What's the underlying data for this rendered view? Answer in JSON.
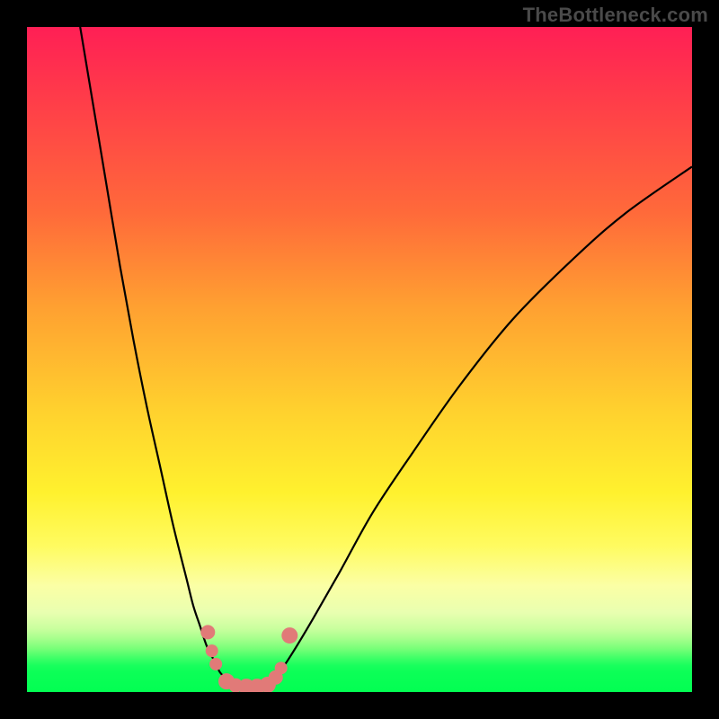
{
  "watermark": {
    "text": "TheBottleneck.com"
  },
  "chart_data": {
    "type": "line",
    "title": "",
    "xlabel": "",
    "ylabel": "",
    "xlim": [
      0,
      100
    ],
    "ylim": [
      0,
      100
    ],
    "grid": false,
    "legend": false,
    "series": [
      {
        "name": "curve-left",
        "x": [
          8,
          10,
          12,
          14,
          16,
          18,
          20,
          22,
          24,
          25,
          26,
          27,
          28,
          29,
          30
        ],
        "y": [
          100,
          88,
          76,
          64,
          53,
          43,
          34,
          25,
          17,
          13,
          10,
          7,
          5,
          3,
          2
        ],
        "stroke": "#000000",
        "stroke_width": 2.2
      },
      {
        "name": "curve-right",
        "x": [
          37,
          38,
          40,
          43,
          47,
          52,
          58,
          65,
          73,
          82,
          90,
          100
        ],
        "y": [
          2,
          3,
          6,
          11,
          18,
          27,
          36,
          46,
          56,
          65,
          72,
          79
        ],
        "stroke": "#000000",
        "stroke_width": 2.2
      },
      {
        "name": "markers",
        "marker_color": "#e17a78",
        "points": [
          {
            "x": 27.2,
            "y": 9.0,
            "r": 8
          },
          {
            "x": 27.8,
            "y": 6.2,
            "r": 7
          },
          {
            "x": 28.4,
            "y": 4.2,
            "r": 7
          },
          {
            "x": 30.0,
            "y": 1.6,
            "r": 9
          },
          {
            "x": 31.4,
            "y": 1.0,
            "r": 8
          },
          {
            "x": 33.0,
            "y": 0.8,
            "r": 9
          },
          {
            "x": 34.6,
            "y": 0.8,
            "r": 9
          },
          {
            "x": 36.2,
            "y": 1.1,
            "r": 9
          },
          {
            "x": 37.4,
            "y": 2.2,
            "r": 8
          },
          {
            "x": 38.2,
            "y": 3.6,
            "r": 7
          },
          {
            "x": 39.5,
            "y": 8.5,
            "r": 9
          }
        ]
      }
    ],
    "gradient_stops": [
      {
        "pos": 0,
        "color": "#ff1f55"
      },
      {
        "pos": 0.42,
        "color": "#ffa031"
      },
      {
        "pos": 0.7,
        "color": "#fff12e"
      },
      {
        "pos": 0.88,
        "color": "#e9ffb0"
      },
      {
        "pos": 1.0,
        "color": "#02ff52"
      }
    ]
  }
}
